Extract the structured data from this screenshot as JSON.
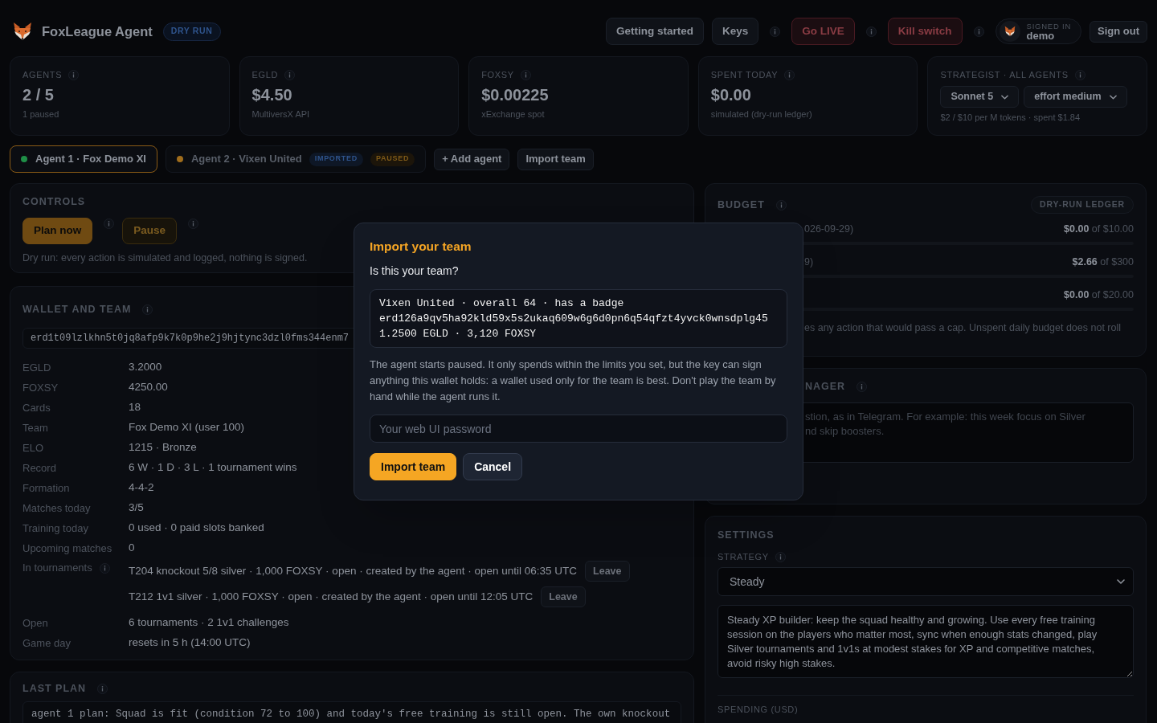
{
  "header": {
    "title": "FoxLeague Agent",
    "mode_badge": "DRY RUN",
    "actions": [
      {
        "label": "Getting started",
        "kind": "default"
      },
      {
        "label": "Keys",
        "kind": "default",
        "info": true
      },
      {
        "label": "Go LIVE",
        "kind": "danger",
        "info": true
      },
      {
        "label": "Kill switch",
        "kind": "danger",
        "info": true
      }
    ],
    "user": {
      "caption": "SIGNED IN",
      "name": "demo"
    },
    "sign_out": "Sign out"
  },
  "stats": [
    {
      "label": "AGENTS",
      "info": true,
      "value": "2 / 5",
      "sub": "1 paused"
    },
    {
      "label": "EGLD",
      "info": true,
      "value": "$4.50",
      "sub": "MultiversX API"
    },
    {
      "label": "FOXSY",
      "info": true,
      "value": "$0.00225",
      "sub": "xExchange spot"
    },
    {
      "label": "SPENT TODAY",
      "info": true,
      "value": "$0.00",
      "sub": "simulated (dry-run ledger)"
    }
  ],
  "strategist": {
    "label": "STRATEGIST · ALL AGENTS",
    "info": true,
    "model": "Sonnet 5",
    "effort": "effort medium",
    "sub": "$2 / $10 per M tokens · spent $1.84"
  },
  "agents": [
    {
      "label": "Agent 1 · Fox Demo XI",
      "selected": true,
      "color": "#1f8f47"
    },
    {
      "label": "Agent 2 · Vixen United",
      "selected": false,
      "color": "#a06d1c",
      "badges": [
        {
          "text": "IMPORTED",
          "kind": "imported"
        },
        {
          "text": "PAUSED",
          "kind": "paused"
        }
      ]
    }
  ],
  "agent_actions": [
    "+ Add agent",
    "Import team"
  ],
  "controls": {
    "heading": "CONTROLS",
    "buttons": [
      {
        "label": "Plan now",
        "kind": "primary",
        "info": true
      },
      {
        "label": "Pause",
        "kind": "warning",
        "info": true
      }
    ],
    "note": "Dry run: every action is simulated and logged, nothing is signed."
  },
  "wallet": {
    "heading": "WALLET AND TEAM",
    "info": true,
    "address": "erd1t09lzlkhn5t0jq8afp9k7k0p9he2j9hjtync3dzl0fms344enm7",
    "rows": [
      {
        "kind": "text",
        "label": "EGLD",
        "value": "3.2000"
      },
      {
        "kind": "text",
        "label": "FOXSY",
        "value": "4250.00"
      },
      {
        "kind": "text",
        "label": "Cards",
        "value": "18"
      },
      {
        "kind": "text",
        "label": "Team",
        "value": "Fox Demo XI (user 100)"
      },
      {
        "kind": "text",
        "label": "ELO",
        "value": "1215 · Bronze"
      },
      {
        "kind": "text",
        "label": "Record",
        "value": "6 W · 1 D · 3 L · 1 tournament wins"
      },
      {
        "kind": "text",
        "label": "Formation",
        "value": "4-4-2"
      },
      {
        "kind": "text",
        "label": "Matches today",
        "value": "3/5"
      },
      {
        "kind": "text",
        "label": "Training today",
        "value": "0 used · 0 paid slots banked"
      },
      {
        "kind": "text",
        "label": "Upcoming matches",
        "value": "0"
      },
      {
        "kind": "list",
        "label": "In tournaments",
        "info": true,
        "entries": [
          {
            "text": "T204 knockout 5/8 silver · 1,000 FOXSY · open · created by the agent · open until 06:35 UTC",
            "button": "Leave"
          },
          {
            "text": "T212 1v1 silver · 1,000 FOXSY · open · created by the agent · open until 12:05 UTC",
            "button": "Leave"
          }
        ]
      },
      {
        "kind": "text",
        "label": "Open",
        "value": "6 tournaments · 2 1v1 challenges"
      },
      {
        "kind": "text",
        "label": "Game day",
        "value": "resets in 5 h (14:00 UTC)"
      }
    ]
  },
  "last_plan": {
    "heading": "LAST PLAN",
    "info": true,
    "text": "agent 1 plan: Squad is fit (condition 72 to 100) and today's free training is still open. The own knockout"
  },
  "budget": {
    "heading": "BUDGET",
    "info": true,
    "badge": "DRY-RUN LEDGER",
    "rows": [
      {
        "label": "026-09-29)",
        "amount": "**$0.00** of $10.00",
        "level": 0
      },
      {
        "label": "9)",
        "amount": "**$2.66** of $300",
        "level": 0.01
      },
      {
        "amount": "**$0.00** of $20.00",
        "level": 0
      }
    ],
    "note": "es any action that would pass a cap. Unspent daily budget does not roll"
  },
  "manager": {
    "heading": "NAGER",
    "info": true,
    "placeholder": "stion, as in Telegram. For example: this week focus on Silver\nnd skip boosters."
  },
  "settings": {
    "heading": "SETTINGS",
    "strategy_label": "STRATEGY",
    "info": true,
    "strategy": "Steady",
    "description": "Steady XP builder: keep the squad healthy and growing. Use every free training session on the players who matter most, sync when enough stats changed, play Silver tournaments and 1v1s at modest stakes for XP and competitive matches, avoid risky high stakes.",
    "spending_label": "SPENDING (USD)"
  },
  "modal": {
    "title": "Import your team",
    "question": "Is this your team?",
    "team_card": [
      "Vixen United · overall 64 · has a badge",
      "erd126a9qv5ha92kld59x5s2ukaq609w6g6d0pn6q54qfzt4yvck0wnsdplg45",
      "1.2500 EGLD · 3,120 FOXSY"
    ],
    "warning": "The agent starts paused. It only spends within the limits you set, but the key can sign anything this wallet holds: a wallet used only for the team is best. Don't play the team by hand while the agent runs it.",
    "password": {
      "placeholder": "Your web UI password"
    },
    "buttons": [
      {
        "label": "Import team",
        "kind": "primary"
      },
      {
        "label": "Cancel",
        "kind": "secondary"
      }
    ]
  }
}
